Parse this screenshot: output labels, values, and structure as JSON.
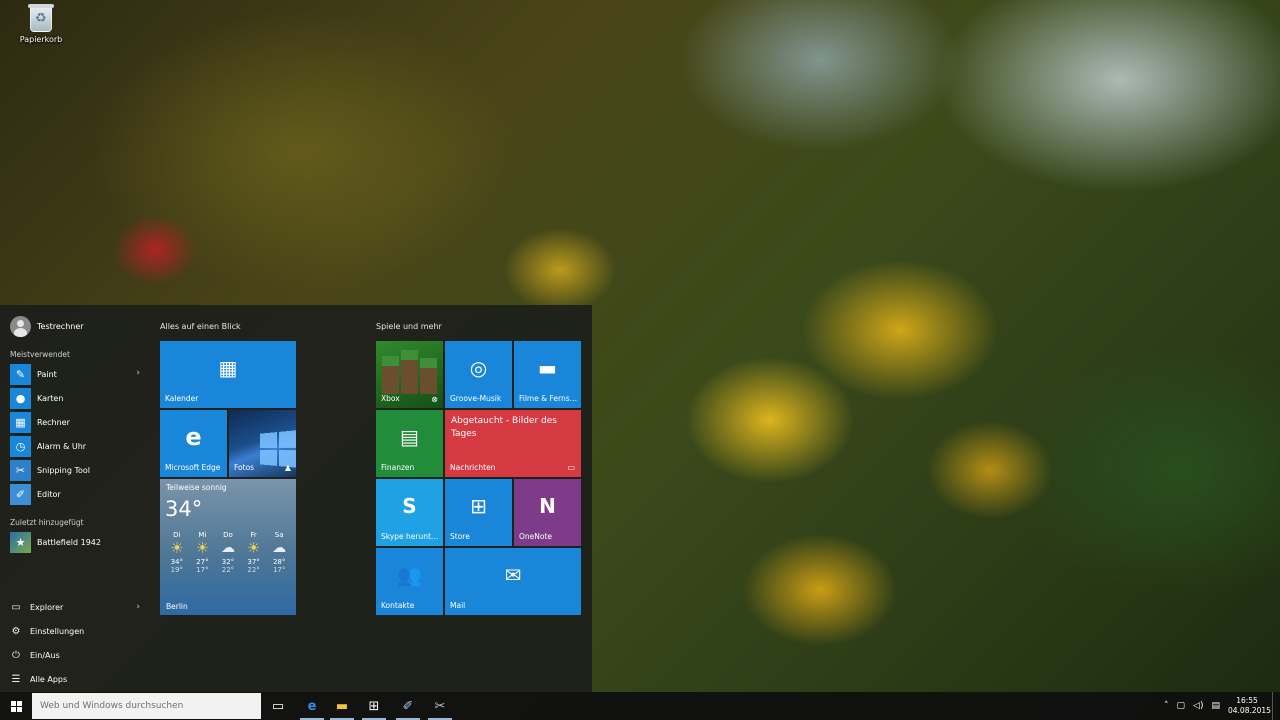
{
  "desktop": {
    "recycle_bin": "Papierkorb"
  },
  "start": {
    "user_name": "Testrechner",
    "most_used_header": "Meistverwendet",
    "most_used": [
      "Paint",
      "Karten",
      "Rechner",
      "Alarm & Uhr",
      "Snipping Tool",
      "Editor"
    ],
    "recent_header": "Zuletzt hinzugefügt",
    "recent": [
      "Battlefield 1942"
    ],
    "system": [
      "Explorer",
      "Einstellungen",
      "Ein/Aus",
      "Alle Apps"
    ],
    "group1_title": "Alles auf einen Blick",
    "group2_title": "Spiele und mehr",
    "tiles": {
      "kalender": "Kalender",
      "edge": "Microsoft Edge",
      "fotos": "Fotos",
      "xbox": "Xbox",
      "groove": "Groove-Musik",
      "filme": "Filme & Ferns…",
      "finanzen": "Finanzen",
      "nachrichten": "Nachrichten",
      "news_headline": "Abgetaucht - Bilder des Tages",
      "skype": "Skype herunt…",
      "store": "Store",
      "onenote": "OneNote",
      "kontakte": "Kontakte",
      "mail": "Mail"
    },
    "weather": {
      "condition": "Teilweise sonnig",
      "temp": "34°",
      "city": "Berlin",
      "days": [
        {
          "day": "Di",
          "hi": "34°",
          "lo": "19°",
          "icon": "sun"
        },
        {
          "day": "Mi",
          "hi": "27°",
          "lo": "17°",
          "icon": "sun"
        },
        {
          "day": "Do",
          "hi": "32°",
          "lo": "22°",
          "icon": "cloud"
        },
        {
          "day": "Fr",
          "hi": "37°",
          "lo": "22°",
          "icon": "sun"
        },
        {
          "day": "Sa",
          "hi": "28°",
          "lo": "17°",
          "icon": "cloud"
        }
      ]
    }
  },
  "taskbar": {
    "search_placeholder": "Web und Windows durchsuchen",
    "time": "16:55",
    "date": "04.08.2015"
  },
  "colors": {
    "tile_blue": "#1a86d9",
    "tile_green": "#218d3b",
    "tile_red": "#d53a43",
    "tile_purple": "#7d3b8a"
  }
}
